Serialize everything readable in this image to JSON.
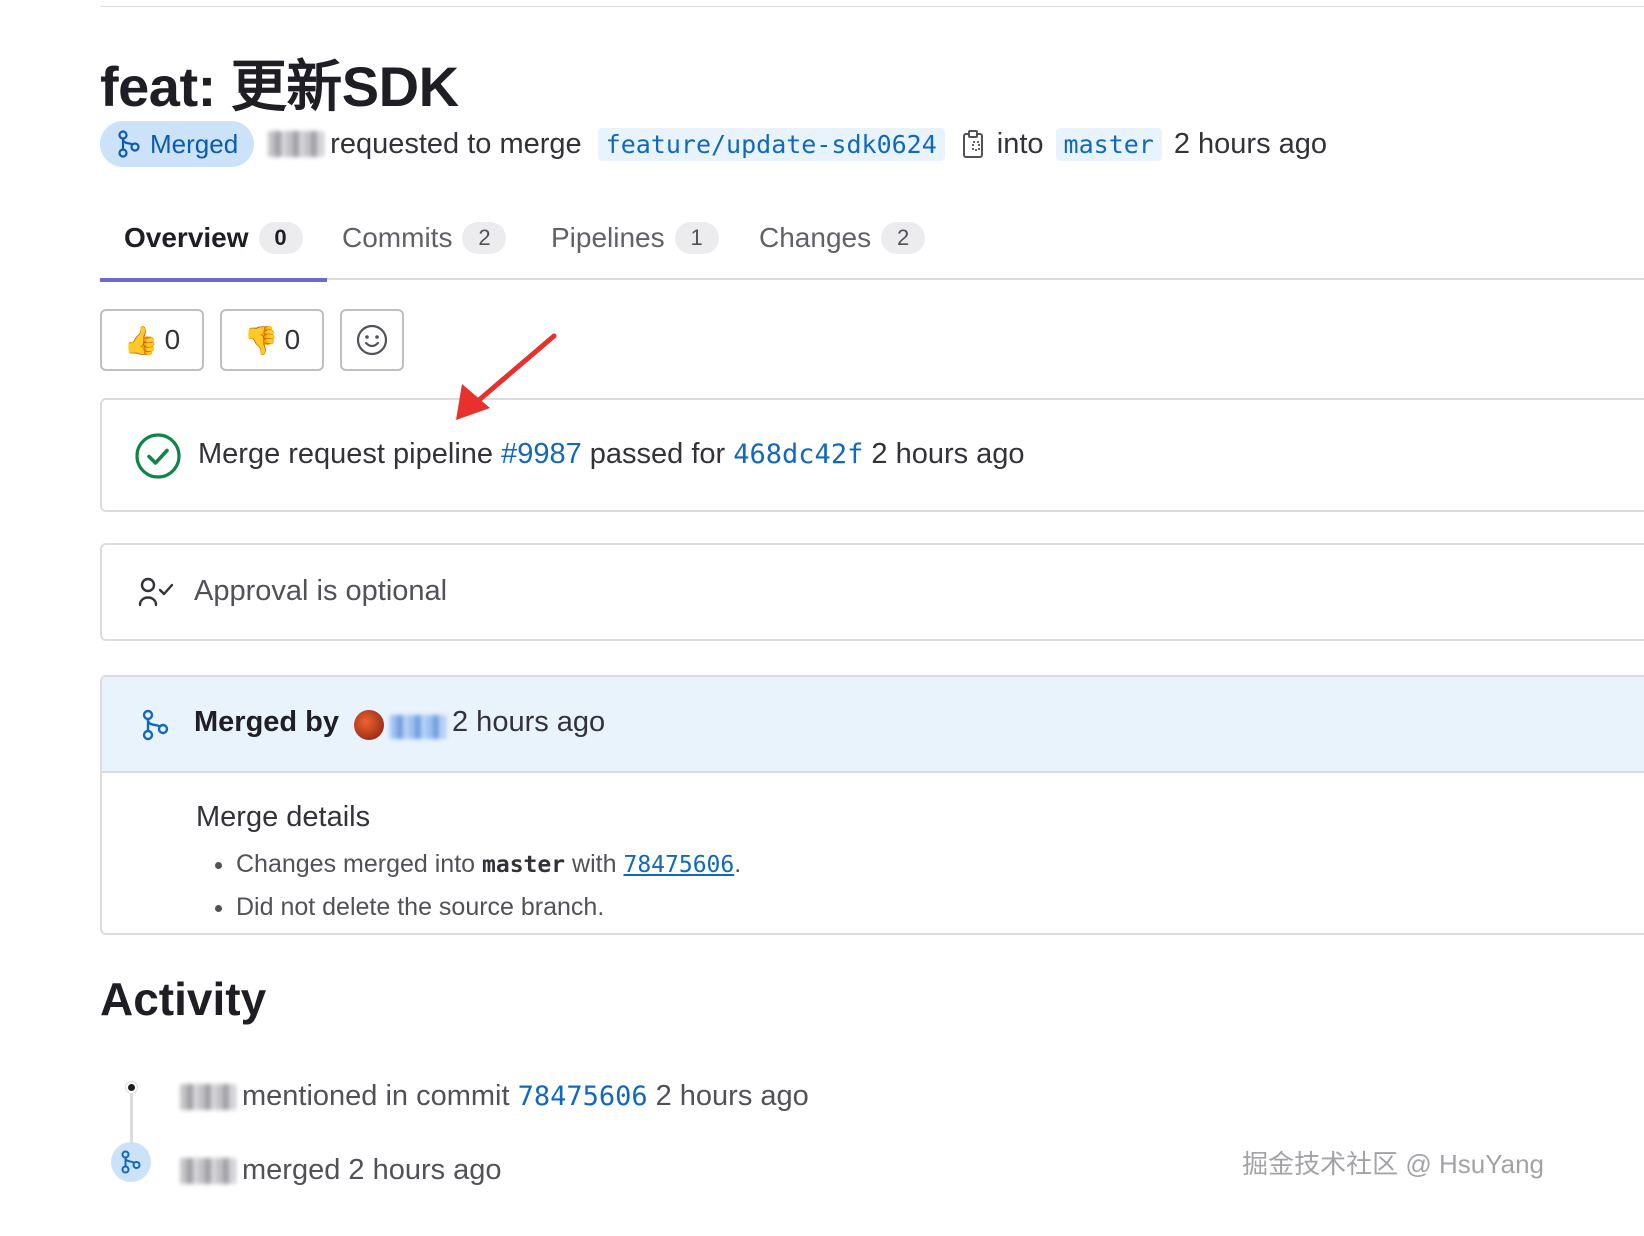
{
  "title": "feat: 更新SDK",
  "meta": {
    "status_label": "Merged",
    "requested_text": "requested to merge",
    "source_branch": "feature/update-sdk0624",
    "into_text": "into",
    "target_branch": "master",
    "time": "2 hours ago"
  },
  "tabs": [
    {
      "label": "Overview",
      "count": "0"
    },
    {
      "label": "Commits",
      "count": "2"
    },
    {
      "label": "Pipelines",
      "count": "1"
    },
    {
      "label": "Changes",
      "count": "2"
    }
  ],
  "reactions": {
    "thumbs_up_count": "0",
    "thumbs_down_count": "0",
    "thumbs_up_glyph": "👍",
    "thumbs_down_glyph": "👎"
  },
  "pipeline": {
    "prefix": "Merge request pipeline",
    "id": "#9987",
    "passed_text": "passed for",
    "commit": "468dc42f",
    "time": "2 hours ago"
  },
  "approval": {
    "text": "Approval is optional"
  },
  "merged": {
    "label": "Merged by",
    "time": "2 hours ago",
    "details_title": "Merge details",
    "line1_prefix": "Changes merged into",
    "line1_branch": "master",
    "line1_with": "with",
    "line1_commit": "78475606",
    "line1_end": ".",
    "line2": "Did not delete the source branch."
  },
  "activity": {
    "heading": "Activity",
    "items": [
      {
        "text": "mentioned in commit",
        "commit": "78475606",
        "time": "2 hours ago"
      },
      {
        "text": "merged 2 hours ago"
      }
    ]
  },
  "watermark": "掘金技术社区 @ HsuYang",
  "colors": {
    "link": "#1068bf",
    "success": "#108548",
    "merged_badge_bg": "#cbe2f9",
    "active_tab_underline": "#6b6ad0",
    "annotation_arrow": "#e8302d"
  }
}
